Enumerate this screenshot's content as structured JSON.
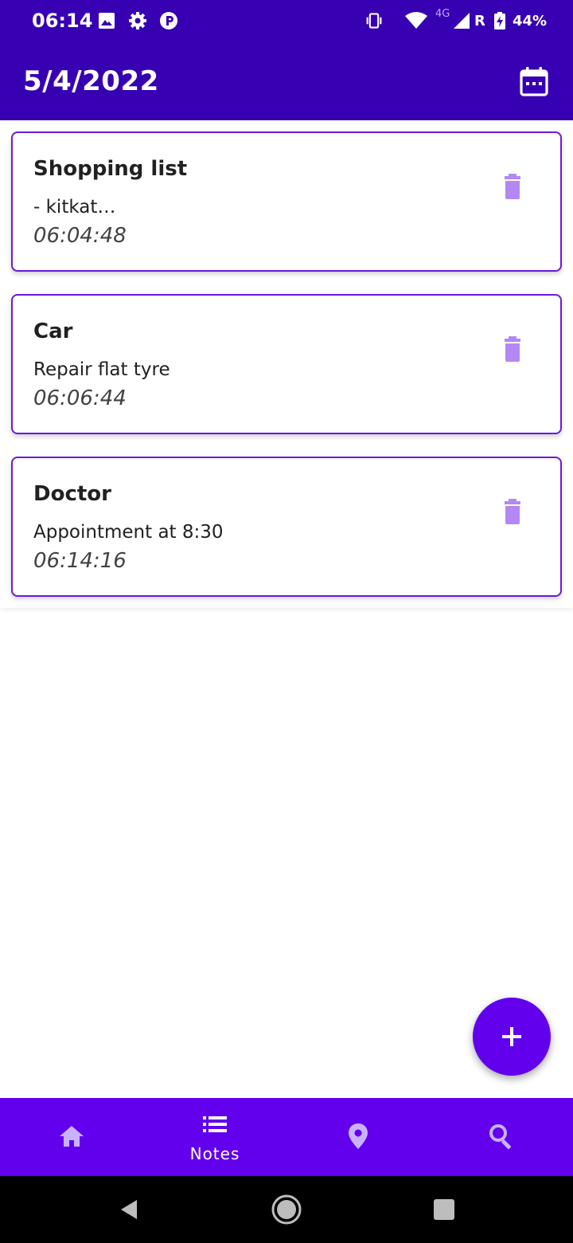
{
  "status_bar": {
    "time": "06:14",
    "network": "4G",
    "roaming": "R",
    "battery": "44%",
    "icons": [
      "image-icon",
      "settings-icon",
      "parking-icon",
      "vibrate-icon",
      "wifi-icon",
      "signal-icon",
      "battery-charging-icon"
    ]
  },
  "app_bar": {
    "title": "5/4/2022",
    "action_icon": "calendar-icon"
  },
  "notes": [
    {
      "title": "Shopping list",
      "body": "- kitkat…",
      "time": "06:04:48"
    },
    {
      "title": "Car",
      "body": "Repair flat tyre",
      "time": "06:06:44"
    },
    {
      "title": "Doctor",
      "body": "Appointment at 8:30",
      "time": "06:14:16"
    }
  ],
  "fab": {
    "icon": "plus-icon"
  },
  "bottom_nav": {
    "items": [
      {
        "icon": "home-icon",
        "label": ""
      },
      {
        "icon": "list-icon",
        "label": "Notes",
        "active": true
      },
      {
        "icon": "location-pin-icon",
        "label": ""
      },
      {
        "icon": "search-icon",
        "label": ""
      }
    ]
  },
  "colors": {
    "app_bar": "#3700b3",
    "primary": "#6200ee",
    "card_border": "#6a1bd9",
    "delete_icon": "#b388f5",
    "nav_inactive_icon": "#c9b2ff"
  }
}
